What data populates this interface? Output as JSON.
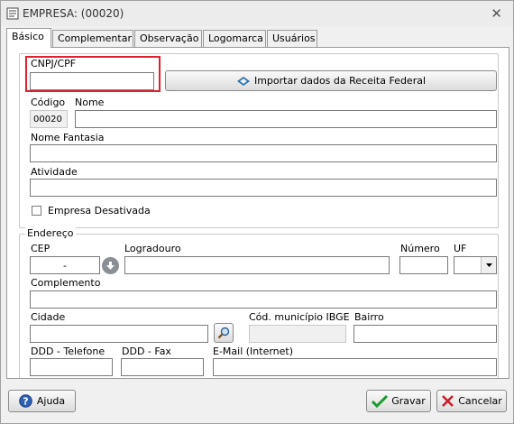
{
  "window": {
    "title": "EMPRESA: (00020)",
    "close_symbol": "✕"
  },
  "tabs": [
    {
      "label": "Básico",
      "active": true
    },
    {
      "label": "Complementar"
    },
    {
      "label": "Observação"
    },
    {
      "label": "Logomarca"
    },
    {
      "label": "Usuários"
    }
  ],
  "identificacao": {
    "cnpj_label": "CNPJ/CPF",
    "cnpj_value": "",
    "import_button": "Importar dados da Receita Federal",
    "codigo_label": "Código",
    "codigo_value": "00020",
    "nome_label": "Nome",
    "nome_value": "",
    "fantasia_label": "Nome Fantasia",
    "fantasia_value": "",
    "atividade_label": "Atividade",
    "atividade_value": "",
    "desativada_label": "Empresa Desativada",
    "desativada_checked": false
  },
  "endereco": {
    "group_label": "Endereço",
    "cep_label": "CEP",
    "cep_value": "-",
    "logradouro_label": "Logradouro",
    "logradouro_value": "",
    "numero_label": "Número",
    "numero_value": "",
    "uf_label": "UF",
    "uf_value": "",
    "complemento_label": "Complemento",
    "complemento_value": "",
    "cidade_label": "Cidade",
    "cidade_value": "",
    "ibge_label": "Cód. município IBGE",
    "ibge_value": "",
    "bairro_label": "Bairro",
    "bairro_value": "",
    "ddd_tel_label": "DDD - Telefone",
    "ddd_fax_label": "DDD - Fax",
    "email_label": "E-Mail (Internet)"
  },
  "footer": {
    "help_button": "Ajuda",
    "save_button": "Gravar",
    "cancel_button": "Cancelar"
  },
  "colors": {
    "highlight": "#e0202c",
    "save_check": "#1a9b2c",
    "cancel_x": "#c8202a",
    "help_icon": "#2d5fb3"
  }
}
